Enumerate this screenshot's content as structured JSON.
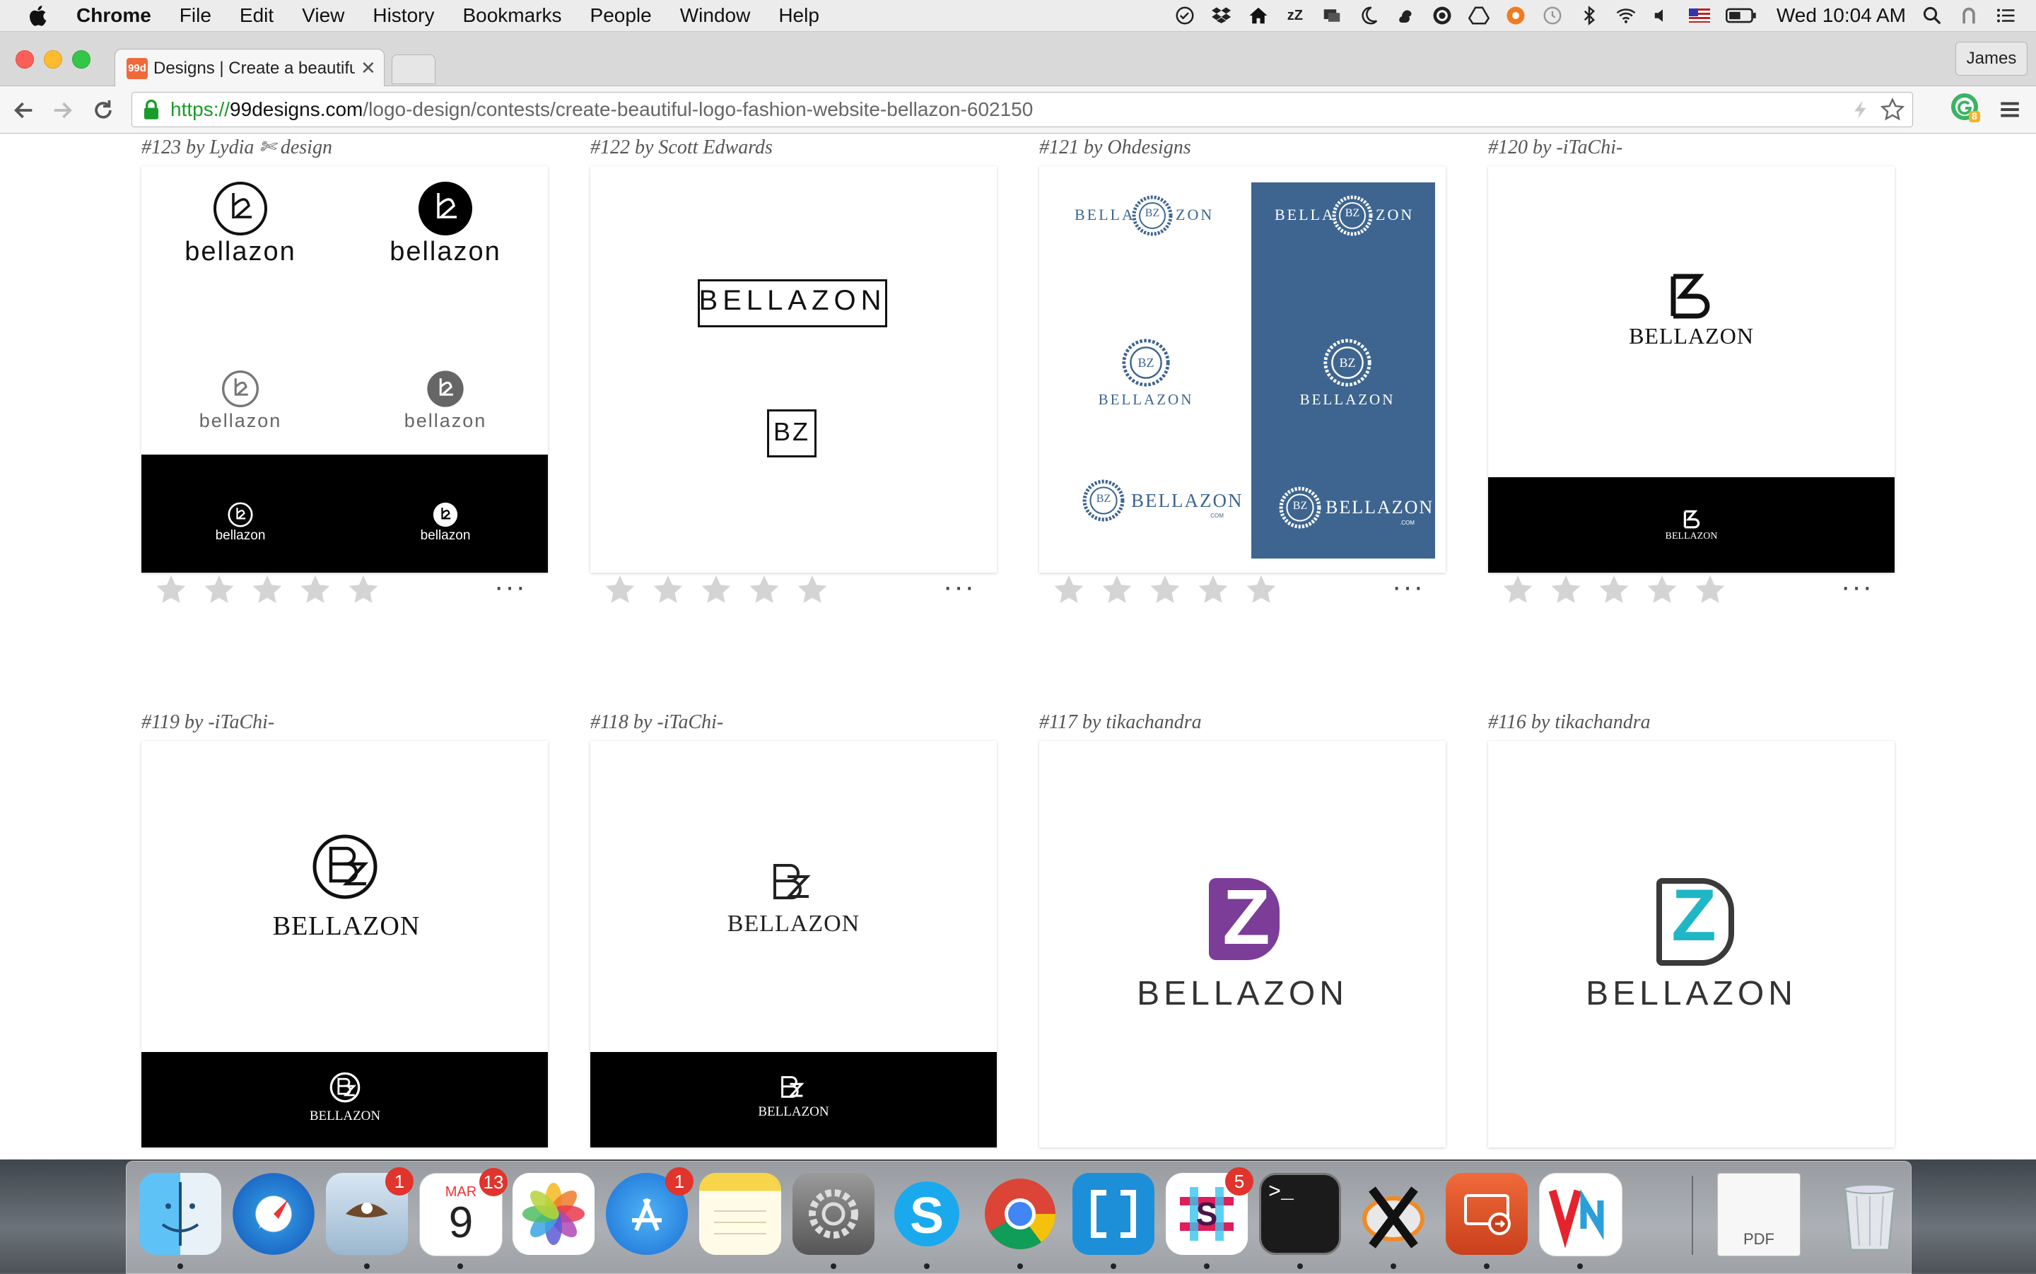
{
  "menubar": {
    "app": "Chrome",
    "items": [
      "File",
      "Edit",
      "View",
      "History",
      "Bookmarks",
      "People",
      "Window",
      "Help"
    ],
    "clock": "Wed 10:04 AM"
  },
  "browser": {
    "tab_title": "Designs | Create a beautiful logo",
    "favicon_text": "99d",
    "profile": "James",
    "url_scheme": "https://",
    "url_host": "99designs.com",
    "url_path": "/logo-design/contests/create-beautiful-logo-fashion-website-bellazon-602150",
    "extension_badge": "8"
  },
  "entries": [
    {
      "label": "#123 by Lydia ✄ design",
      "design": "bellazon-script"
    },
    {
      "label": "#122 by Scott Edwards",
      "design": "boxed"
    },
    {
      "label": "#121 by Ohdesigns",
      "design": "crest"
    },
    {
      "label": "#120 by -iTaChi-",
      "design": "b-mono"
    },
    {
      "label": "#119 by -iTaChi-",
      "design": "bz-circle"
    },
    {
      "label": "#118 by -iTaChi-",
      "design": "bz-stacked"
    },
    {
      "label": "#117 by tikachandra",
      "design": "z-purple"
    },
    {
      "label": "#116 by tikachandra",
      "design": "z-teal"
    }
  ],
  "logos": {
    "lower": "bellazon",
    "upper": "BELLAZON",
    "bz": "BZ",
    "bella": "BELLA",
    "zon": "ZON",
    "dotcom": ".COM",
    "z": "Z",
    "b": "B"
  },
  "colors": {
    "crest_blue": "#3d6590",
    "purple": "#7b3d98",
    "teal": "#1fb6c6",
    "star": "#d4d4d4"
  },
  "rating": {
    "stars": 5,
    "more": "···"
  },
  "dock": {
    "apps": [
      {
        "name": "Finder",
        "badge": ""
      },
      {
        "name": "Safari",
        "badge": ""
      },
      {
        "name": "Mail",
        "badge": "1"
      },
      {
        "name": "Calendar",
        "badge": "13",
        "month": "MAR",
        "day": "9"
      },
      {
        "name": "Photos",
        "badge": ""
      },
      {
        "name": "App Store",
        "badge": "1"
      },
      {
        "name": "Notes",
        "badge": ""
      },
      {
        "name": "System Preferences",
        "badge": ""
      },
      {
        "name": "Skype",
        "badge": ""
      },
      {
        "name": "Chrome",
        "badge": ""
      },
      {
        "name": "Brackets",
        "badge": ""
      },
      {
        "name": "Slack",
        "badge": "5"
      },
      {
        "name": "Terminal",
        "badge": "",
        "text": ">_"
      },
      {
        "name": "X11",
        "badge": ""
      },
      {
        "name": "Remote Desktop",
        "badge": ""
      },
      {
        "name": "VNC Viewer",
        "badge": ""
      },
      {
        "name": "PDF",
        "badge": "",
        "text": "PDF"
      },
      {
        "name": "Trash",
        "badge": ""
      }
    ]
  }
}
